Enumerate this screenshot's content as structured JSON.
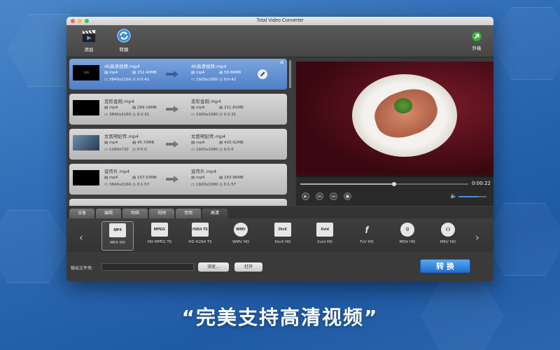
{
  "window": {
    "title": "Total Video Converter"
  },
  "toolbar": {
    "add_label": "添加",
    "convert_label": "转换",
    "upgrade_label": "升级"
  },
  "files": [
    {
      "src_name": "4k高清视频.mp4",
      "src_fmt": "mp4",
      "src_size": "252.40MB",
      "src_res": "3840x2160",
      "src_dur": "0:0:42",
      "dst_name": "4k高清视频.mp4",
      "dst_fmt": "mp4",
      "dst_size": "58.86MB",
      "dst_res": "1920x1080",
      "dst_dur": "0:0:42"
    },
    {
      "src_name": "变形金刚.mp4",
      "src_fmt": "mp4",
      "src_size": "289.19MB",
      "src_res": "3840x2160",
      "src_dur": "0:2:31",
      "dst_name": "变形金刚.mp4",
      "dst_fmt": "mp4",
      "dst_size": "211.81MB",
      "dst_res": "1920x1080",
      "dst_dur": "0:2:31"
    },
    {
      "src_name": "女医明妃传.mp4",
      "src_fmt": "mp4",
      "src_size": "45.70MB",
      "src_res": "1280x720",
      "src_dur": "0:5:0",
      "dst_name": "女医明妃传.mp4",
      "dst_fmt": "mp4",
      "dst_size": "420.42MB",
      "dst_res": "1920x1080",
      "dst_dur": "0:5:0"
    },
    {
      "src_name": "宣传片.mp4",
      "src_fmt": "mp4",
      "src_size": "157.03MB",
      "src_res": "3840x2160",
      "src_dur": "0:1:57",
      "dst_name": "宣传片.mp4",
      "dst_fmt": "mp4",
      "dst_size": "163.96MB",
      "dst_res": "1920x1080",
      "dst_dur": "0:1:57"
    }
  ],
  "player": {
    "time": "0:00:22",
    "progress": 0.55,
    "volume": 0.7
  },
  "tabs": [
    "设备",
    "编辑",
    "网络",
    "视频",
    "音频",
    "高清"
  ],
  "active_tab": "高清",
  "formats": [
    {
      "icon_text": "MP4",
      "label": "MP4 HD"
    },
    {
      "icon_text": "MPEG TS",
      "label": "HD MPEG TS"
    },
    {
      "icon_text": "H264 TS",
      "label": "HD H264 TS"
    },
    {
      "icon_text": "WMV",
      "label": "WMV HD"
    },
    {
      "icon_text": "DivX",
      "label": "DivX HD"
    },
    {
      "icon_text": "Xvid",
      "label": "Xvid HD"
    },
    {
      "icon_text": "f",
      "label": "FLV HD"
    },
    {
      "icon_text": "Q",
      "label": "MOV HD"
    },
    {
      "icon_text": "{ }",
      "label": "MKV HD"
    }
  ],
  "output": {
    "label": "输出文件夹:",
    "browse_label": "浏览...",
    "open_label": "打开"
  },
  "convert_button": "转 换",
  "thumb_label": "128",
  "caption": "“完美支持高清视频”",
  "colors": {
    "accent": "#4f7fc6",
    "convert": "#1f6fd0"
  }
}
